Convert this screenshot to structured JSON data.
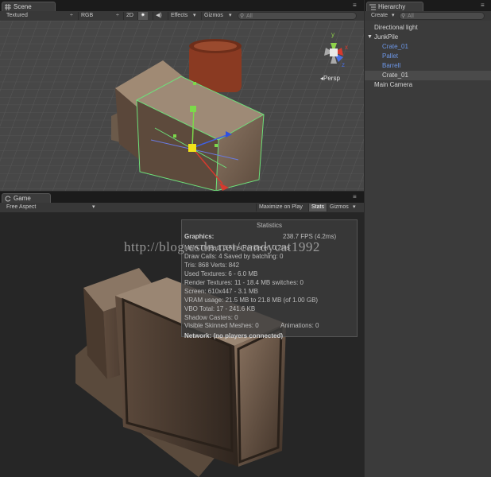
{
  "scene": {
    "tab_label": "Scene",
    "toolbar": {
      "render_mode": "Textured",
      "color_mode": "RGB",
      "two_d": "2D",
      "lighting_icon": "sun-icon",
      "audio_icon": "speaker-icon",
      "effects": "Effects",
      "gizmos": "Gizmos",
      "search_placeholder": "All"
    },
    "persp_label": "Persp",
    "gizmo_axes": [
      "y",
      "x",
      "z"
    ]
  },
  "game": {
    "tab_label": "Game",
    "aspect": "Free Aspect",
    "maximize_on_play": "Maximize on Play",
    "stats": "Stats",
    "gizmos": "Gizmos"
  },
  "statistics": {
    "title": "Statistics",
    "graphics_label": "Graphics:",
    "fps": "238.7 FPS (4.2ms)",
    "main_thread": "Main Thread: 3.6ms  Renderer: 0.2ms",
    "draw_calls": "Draw Calls: 4  Saved by batching: 0",
    "tris": "Tris: 868   Verts: 842",
    "used_textures": "Used Textures: 6 - 6.0 MB",
    "render_textures": "Render Textures: 11 - 18.4 MB   switches: 0",
    "screen": "Screen: 610x447 - 3.1 MB",
    "vram": "VRAM usage: 21.5 MB to 21.8 MB (of 1.00 GB)",
    "vbo": "VBO Total: 17 - 241.6 KB",
    "shadow_casters": "Shadow Casters: 0",
    "skinned_meshes": "Visible Skinned Meshes: 0",
    "animations": "Animations: 0",
    "network": "Network: (no players connected)"
  },
  "watermark": "http://blog.csdn.net/candycat1992",
  "hierarchy": {
    "tab_label": "Hierarchy",
    "create": "Create",
    "search_placeholder": "All",
    "items": [
      {
        "label": "Directional light",
        "indent": 0,
        "color": "#d4d4d4"
      },
      {
        "label": "JunkPile",
        "indent": 0,
        "color": "#d4d4d4",
        "expanded": true
      },
      {
        "label": "Crate_01",
        "indent": 1,
        "color": "#6c96e6"
      },
      {
        "label": "Pallet",
        "indent": 1,
        "color": "#6c96e6"
      },
      {
        "label": "Barrell",
        "indent": 1,
        "color": "#6c96e6"
      },
      {
        "label": "Crate_01",
        "indent": 1,
        "color": "#d4d4d4",
        "selected": true
      },
      {
        "label": "Main Camera",
        "indent": 0,
        "color": "#d4d4d4"
      }
    ]
  },
  "colors": {
    "tab_bg": "#3c3c3c",
    "panel_bg": "#3b3b3b",
    "prefab_blue": "#6c96e6",
    "selection_green": "#7fe07f"
  }
}
